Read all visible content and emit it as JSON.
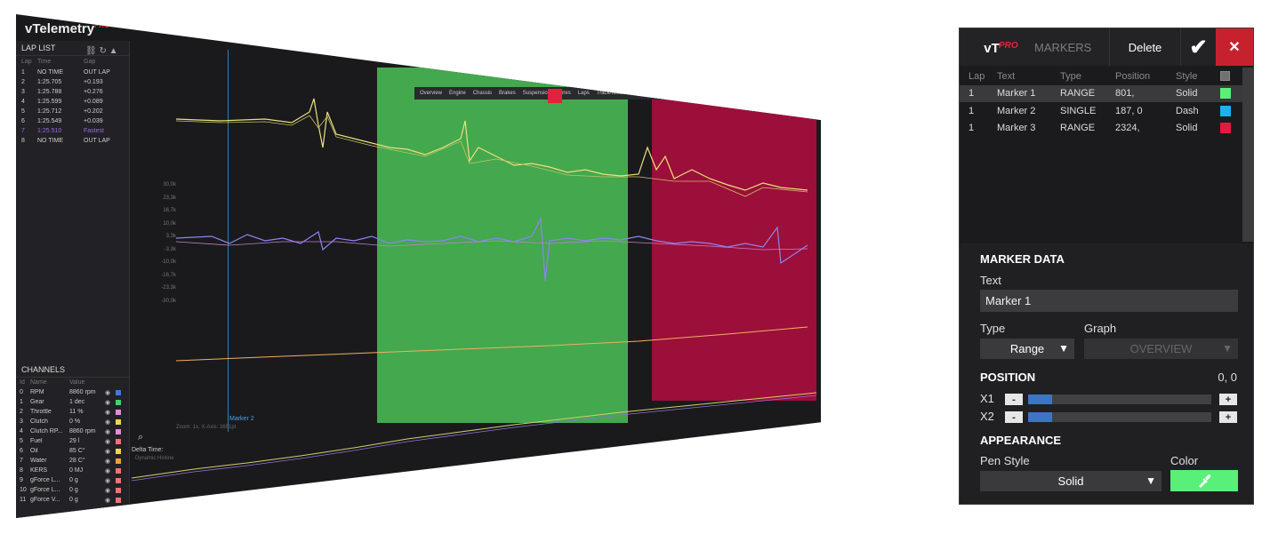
{
  "telemetry": {
    "app_logo": "vTelemetry",
    "app_logo_sup": "PRO",
    "lap_list": {
      "title": "LAP LIST",
      "headers": [
        "Lap",
        "Time",
        "Gap"
      ],
      "rows": [
        {
          "lap": "1",
          "time": "NO TIME",
          "gap": "OUT LAP"
        },
        {
          "lap": "2",
          "time": "1:25.705",
          "gap": "+0.193"
        },
        {
          "lap": "3",
          "time": "1:25.788",
          "gap": "+0.276"
        },
        {
          "lap": "4",
          "time": "1:25.599",
          "gap": "+0.089"
        },
        {
          "lap": "5",
          "time": "1:25.712",
          "gap": "+0.202"
        },
        {
          "lap": "6",
          "time": "1:25.549",
          "gap": "+0.039"
        },
        {
          "lap": "7",
          "time": "1:25.510",
          "gap": "Fastest"
        },
        {
          "lap": "8",
          "time": "NO TIME",
          "gap": "OUT LAP"
        }
      ]
    },
    "channels": {
      "title": "CHANNELS",
      "headers": [
        "Id",
        "Name",
        "Value"
      ],
      "rows": [
        {
          "id": "0",
          "name": "RPM",
          "value": "8860 rpm",
          "color": "#3a7be0"
        },
        {
          "id": "1",
          "name": "Gear",
          "value": "1 dec",
          "color": "#44d36a"
        },
        {
          "id": "2",
          "name": "Throttle",
          "value": "11 %",
          "color": "#e58ad8"
        },
        {
          "id": "3",
          "name": "Clutch",
          "value": "0 %",
          "color": "#f0d84a"
        },
        {
          "id": "4",
          "name": "Clutch RP...",
          "value": "8860 rpm",
          "color": "#e58ad8"
        },
        {
          "id": "5",
          "name": "Fuel",
          "value": "29 l",
          "color": "#f07272"
        },
        {
          "id": "6",
          "name": "Oil",
          "value": "85 C°",
          "color": "#f0d84a"
        },
        {
          "id": "7",
          "name": "Water",
          "value": "28 C°",
          "color": "#f0a030"
        },
        {
          "id": "8",
          "name": "KERS",
          "value": "0 MJ",
          "color": "#f07272"
        },
        {
          "id": "9",
          "name": "gForce L...",
          "value": "0 g",
          "color": "#f07272"
        },
        {
          "id": "10",
          "name": "gForce L...",
          "value": "0 g",
          "color": "#f07272"
        },
        {
          "id": "11",
          "name": "gForce V...",
          "value": "0 g",
          "color": "#f07272"
        }
      ]
    },
    "toolbar_items": [
      "Overview",
      "Engine",
      "Chassis",
      "Brakes",
      "Suspension",
      "Tyres",
      "Laps",
      "Track/Weather",
      "Bodyg"
    ],
    "y_ticks": [
      "30,0k",
      "23,3k",
      "16,7k",
      "10,0k",
      "3,3k",
      "-3,3k",
      "-10,0k",
      "-16,7k",
      "-23,3k",
      "-30,0k"
    ],
    "marker2_label": "Marker 2",
    "zoom_label": "Zoom: 1x, X-Axis: 3651pt",
    "delta_time_label": "Delta Time:",
    "delta_sub_label": "Dynamic Hinline",
    "colors": {
      "green_band": "#44a84e",
      "red_band": "#9c0f3a",
      "trace_yellow": "#e8e27a",
      "trace_purple": "#8a86f0",
      "trace_orange": "#f0b060"
    }
  },
  "panel": {
    "logo": "vT",
    "logo_sup": "PRO",
    "title": "MARKERS",
    "delete_label": "Delete",
    "confirm_icon": "checkmark-icon",
    "close_icon": "close-icon",
    "table": {
      "headers": {
        "lap": "Lap",
        "text": "Text",
        "type": "Type",
        "position": "Position",
        "style": "Style"
      },
      "rows": [
        {
          "lap": "1",
          "text": "Marker 1",
          "type": "RANGE",
          "position": "801,",
          "style": "Solid",
          "color": "#58f078",
          "selected": true
        },
        {
          "lap": "1",
          "text": "Marker 2",
          "type": "SINGLE",
          "position": "187, 0",
          "style": "Dash",
          "color": "#19b1ee",
          "selected": false
        },
        {
          "lap": "1",
          "text": "Marker 3",
          "type": "RANGE",
          "position": "2324,",
          "style": "Solid",
          "color": "#e4193f",
          "selected": false
        }
      ]
    },
    "marker_data": {
      "section_title": "MARKER DATA",
      "text_label": "Text",
      "text_value": "Marker 1",
      "type_label": "Type",
      "type_value": "Range",
      "graph_label": "Graph",
      "graph_value": "OVERVIEW"
    },
    "position": {
      "section_title": "POSITION",
      "value": "0, 0",
      "x1_label": "X1",
      "x2_label": "X2",
      "minus": "-",
      "plus": "+",
      "x1_fill": 0.13,
      "x2_fill": 0.13
    },
    "appearance": {
      "section_title": "APPEARANCE",
      "pen_style_label": "Pen Style",
      "pen_style_value": "Solid",
      "color_label": "Color",
      "color_value": "#58f078",
      "picker_icon": "eyedropper-icon"
    }
  }
}
